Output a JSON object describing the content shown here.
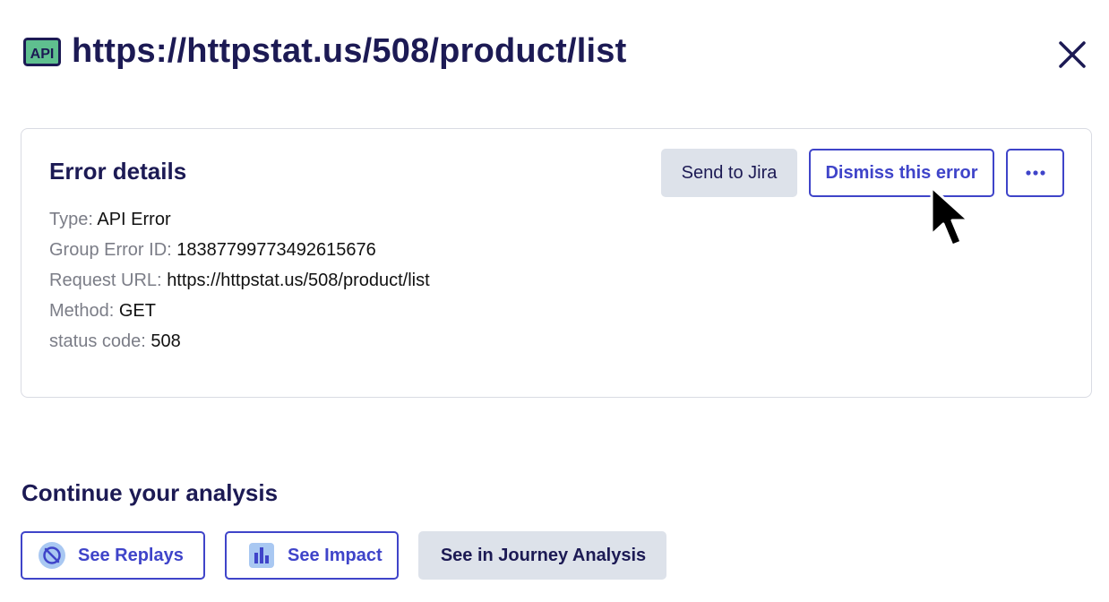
{
  "header": {
    "icon": "api-icon",
    "icon_text": "API",
    "title": "https://httpstat.us/508/product/list"
  },
  "close": {
    "icon": "close-icon"
  },
  "error_card": {
    "title": "Error details",
    "actions": {
      "send_to_jira": "Send to Jira",
      "dismiss": "Dismiss this error",
      "more": "···"
    },
    "details": [
      {
        "label": "Type:",
        "value": "API Error"
      },
      {
        "label": "Group Error ID:",
        "value": "18387799773492615676"
      },
      {
        "label": "Request URL:",
        "value": "https://httpstat.us/508/product/list"
      },
      {
        "label": "Method:",
        "value": "GET"
      },
      {
        "label": "status code:",
        "value": "508"
      }
    ]
  },
  "analysis": {
    "title": "Continue your analysis",
    "see_replays": "See Replays",
    "see_impact": "See Impact",
    "see_journey": "See in Journey Analysis"
  },
  "colors": {
    "title": "#1c1a54",
    "accent": "#3f44c9",
    "grey_button": "#dde2ea",
    "api_icon_bg": "#5fbf8f"
  }
}
